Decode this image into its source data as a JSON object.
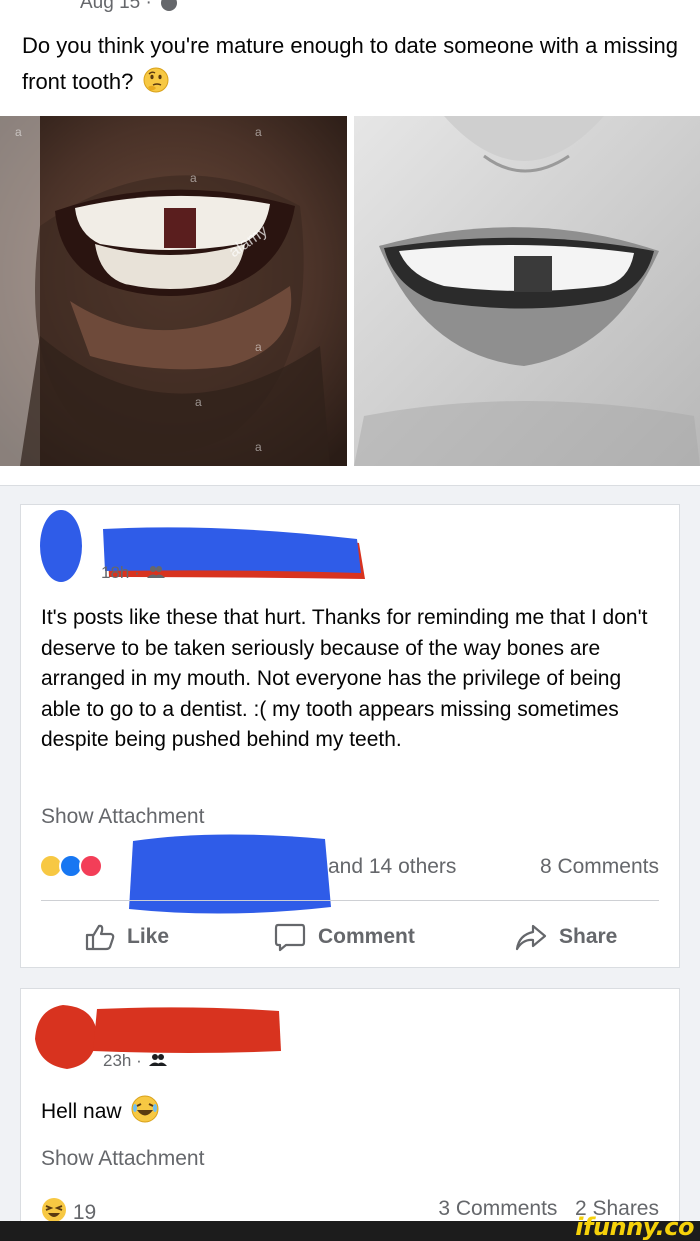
{
  "post": {
    "date": "Aug 15 ·",
    "text": "Do you think you're mature enough to date someone with a missing front tooth?",
    "emoji": "thinking-face"
  },
  "photos": {
    "watermark": "alamy",
    "watermark_letter": "a"
  },
  "comment1": {
    "time": "18h ·",
    "text": "It's posts like these that hurt. Thanks for reminding me that I don't deserve to be taken seriously because of the way bones are arranged in my mouth. Not everyone has the privilege of being able to go to a dentist. :( my tooth appears missing sometimes despite being pushed behind my teeth.",
    "attachment": "Show Attachment",
    "reactions_others": "and 14 others",
    "comments_count": "8 Comments",
    "actions": {
      "like": "Like",
      "comment": "Comment",
      "share": "Share"
    },
    "reaction_icons": [
      "care-icon",
      "like-icon",
      "love-icon"
    ]
  },
  "comment2": {
    "time": "23h ·",
    "text": "Hell naw",
    "emoji": "laughing-face",
    "attachment": "Show Attachment",
    "reactions_count": "19",
    "comments_count": "3 Comments",
    "shares_count": "2 Shares"
  },
  "branding": {
    "watermark": "ifunny.co"
  },
  "colors": {
    "redact_blue": "#2f5ce8",
    "redact_red": "#d8331f",
    "secondary_text": "#65676b",
    "watermark_yellow": "#f5d10a"
  }
}
